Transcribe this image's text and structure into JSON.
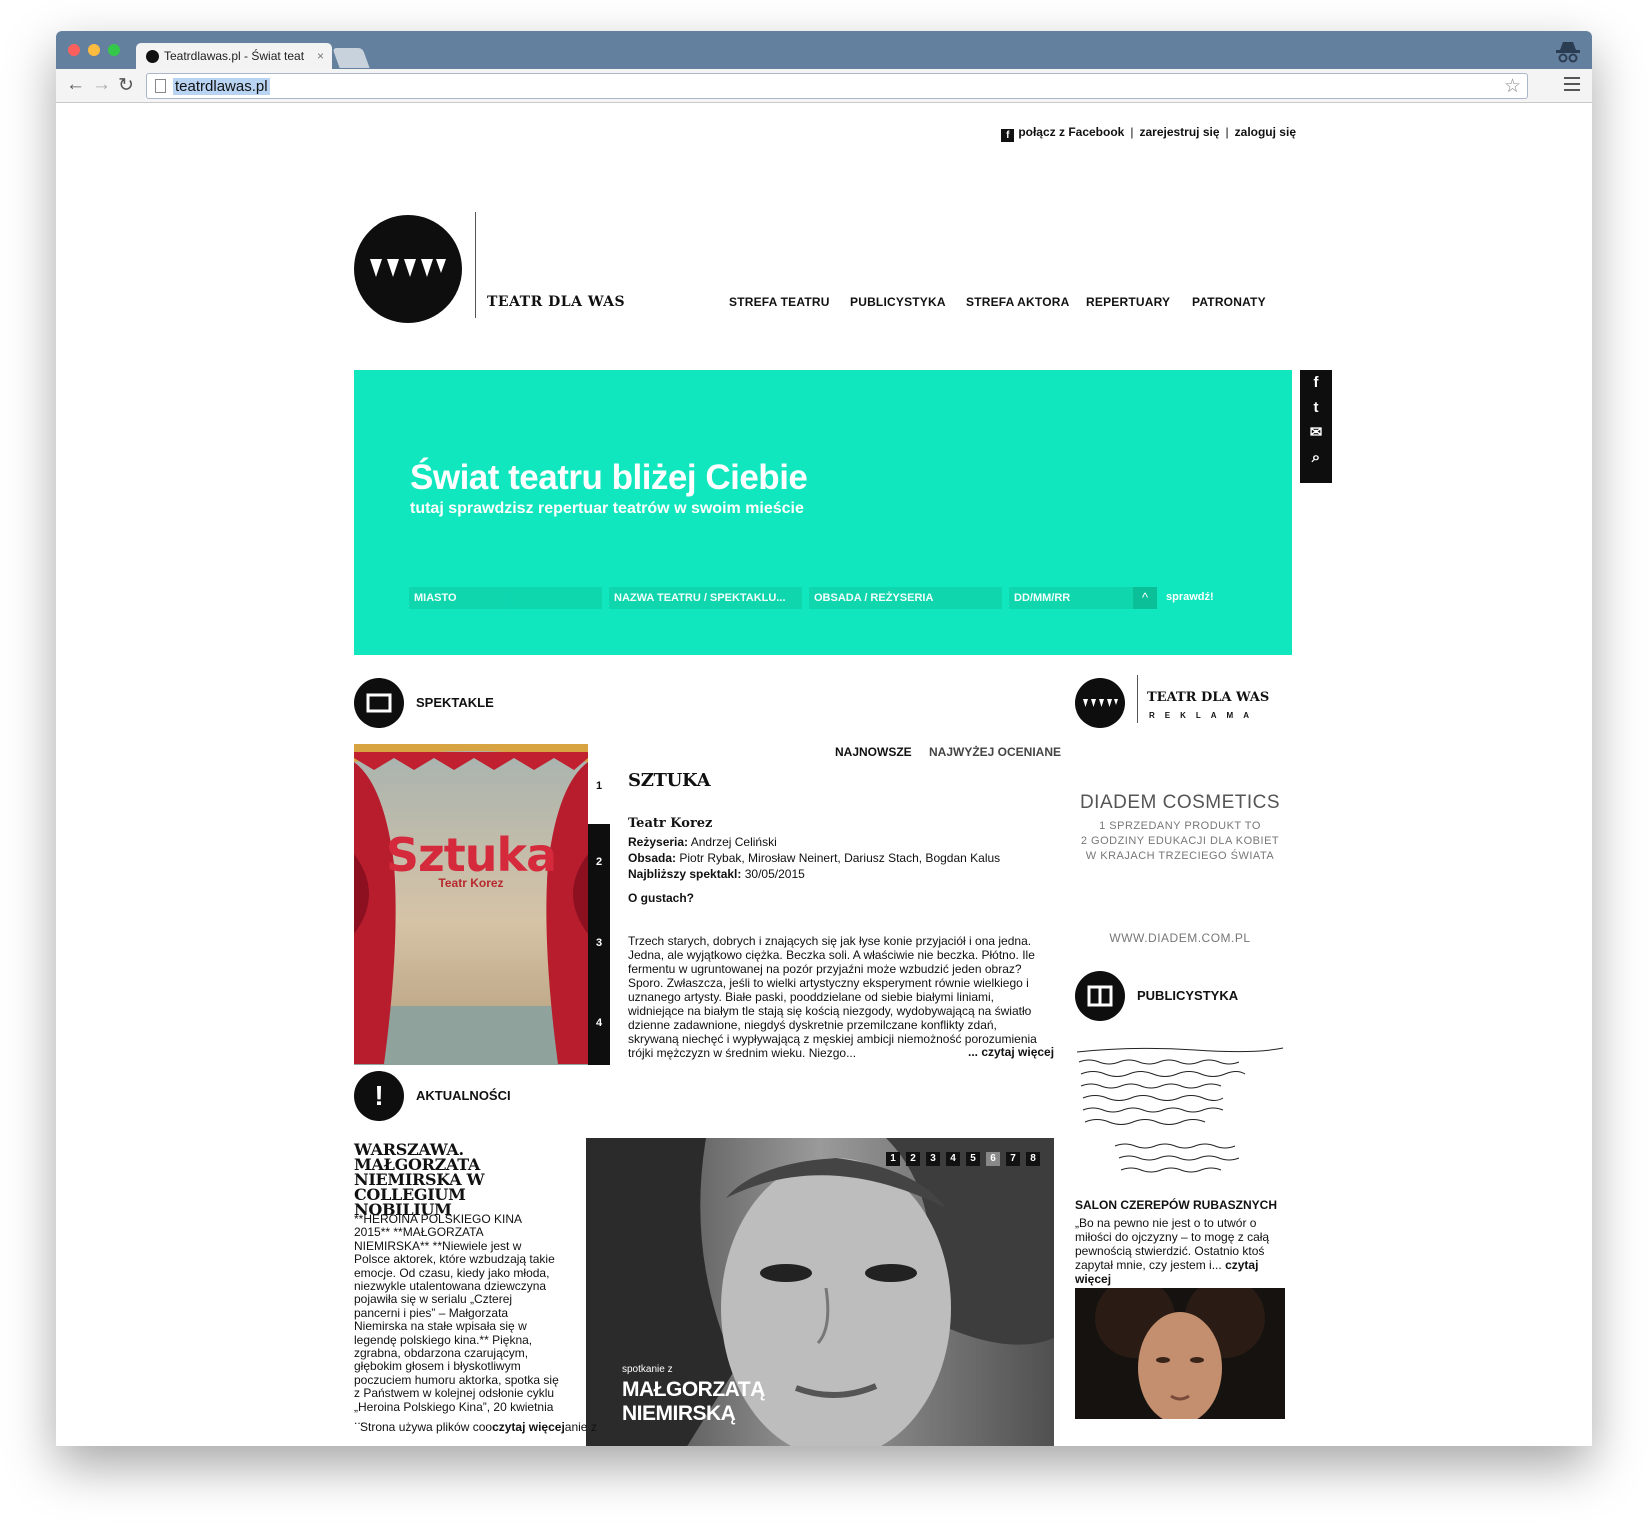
{
  "browser": {
    "tab_title": "Teatrdlawas.pl - Świat teat",
    "tab_close": "×",
    "url": "teatrdlawas.pl",
    "back_icon": "←",
    "forward_icon": "→",
    "reload_icon": "↻",
    "star_icon": "☆"
  },
  "top_links": {
    "facebook": "połącz z Facebook",
    "sep1": "|",
    "register": "zarejestruj się",
    "sep2": "|",
    "login": "zaloguj się"
  },
  "brand": {
    "name": "TEATR DLA WAS"
  },
  "nav": [
    "STREFA TEATRU",
    "PUBLICYSTYKA",
    "STREFA AKTORA",
    "REPERTUARY",
    "PATRONATY"
  ],
  "hero": {
    "title": "Świat teatru bliżej Ciebie",
    "subtitle": "tutaj sprawdzisz repertuar teatrów w swoim mieście",
    "placeholders": [
      "MIASTO",
      "NAZWA TEATRU / SPEKTAKLU...",
      "OBSADA / REŻYSERIA",
      "DD/MM/RR"
    ],
    "check_label": "sprawdź!",
    "bg_color": "#10e7be"
  },
  "share": [
    "f",
    "t",
    "✉",
    "⌕"
  ],
  "spektakle": {
    "heading": "SPEKTAKLE",
    "sort": [
      "NAJNOWSZE",
      "NAJWYŻEJ OCENIANE"
    ],
    "numbers": [
      "1",
      "2",
      "3",
      "4"
    ],
    "poster_title": "Sztuka",
    "poster_venue": "Teatr Korez",
    "title": "SZTUKA",
    "venue": "Teatr Korez",
    "director_label": "Reżyseria:",
    "director": "Andrzej Celiński",
    "cast_label": "Obsada:",
    "cast": "Piotr Rybak, Mirosław Neinert, Dariusz Stach, Bogdan Kalus",
    "next_label": "Najbliższy spektakl:",
    "next_date": "30/05/2015",
    "tagline": "O gustach?",
    "description": "Trzech starych, dobrych i znających się jak łyse konie przyjaciół i ona jedna. Jedna, ale wyjątkowo ciężka. Beczka soli. A właściwie nie beczka. Płótno. Ile fermentu w ugruntowanej na pozór przyjaźni może wzbudzić jeden obraz? Sporo. Zwłaszcza, jeśli to wielki artystyczny eksperyment równie wielkiego i uznanego artysty. Białe paski, pooddzielane od siebie białymi liniami, widniejące na białym tle stają się kością niezgody, wydobywającą na światło dzienne zadawnione, niegdyś dyskretnie przemilczane konflikty zdań, skrywaną niechęć i wypływającą z męskiej ambicji niemożność porozumienia trójki mężczyzn w średnim wieku. Niezgo...",
    "read_more": "... czytaj więcej"
  },
  "ad": {
    "brand": "TEATR DLA WAS",
    "sub": "REKLAMA",
    "headline": "DIADEM COSMETICS",
    "lines": [
      "1 SPRZEDANY PRODUKT TO",
      "2 GODZINY EDUKACJI DLA KOBIET",
      "W KRAJACH TRZECIEGO ŚWIATA"
    ],
    "url": "WWW.DIADEM.COM.PL"
  },
  "publicystyka": {
    "heading": "PUBLICYSTYKA",
    "article_title": "SALON CZEREPÓW RUBASZNYCH",
    "article_text": "„Bo na pewno nie jest o to utwór o miłości do ojczyzny – to mogę z całą pewnością stwierdzić. Ostatnio ktoś zapytał mnie, czy jestem i...",
    "read_more": "czytaj więcej"
  },
  "aktualnosci": {
    "heading": "AKTUALNOŚCI",
    "icon": "!",
    "title": "WARSZAWA. MAŁGORZATA NIEMIRSKA W COLLEGIUM NOBILIUM",
    "text": "**HEROINA POLSKIEGO KINA 2015** **MAŁGORZATA NIEMIRSKA** **Niewiele jest w Polsce aktorek, które wzbudzają takie emocje. Od czasu, kiedy jako młoda, niezwykle utalentowana dziewczyna pojawiła się w serialu „Czterej pancerni i pies” – Małgorzata Niemirska na stałe wpisała się w legendę polskiego kina.** Piękna, zgrabna, obdarzona czarującym, głębokim głosem i błyskotliwym poczuciem humoru aktorka, spotka się z Państwem w kolejnej odsłonie cyklu „Heroina Polskiego Kina”, 20 kwietnia ...",
    "pager": [
      "1",
      "2",
      "3",
      "4",
      "5",
      "6",
      "7",
      "8"
    ],
    "active_page": "6",
    "caption_small": "spotkanie z",
    "caption_line1": "MAŁGORZATĄ",
    "caption_line2": "NIEMIRSKĄ"
  },
  "cookie": {
    "text_start": "Strona używa plików coo",
    "read_more": "czytaj więcej",
    "text_end": "anie z"
  }
}
